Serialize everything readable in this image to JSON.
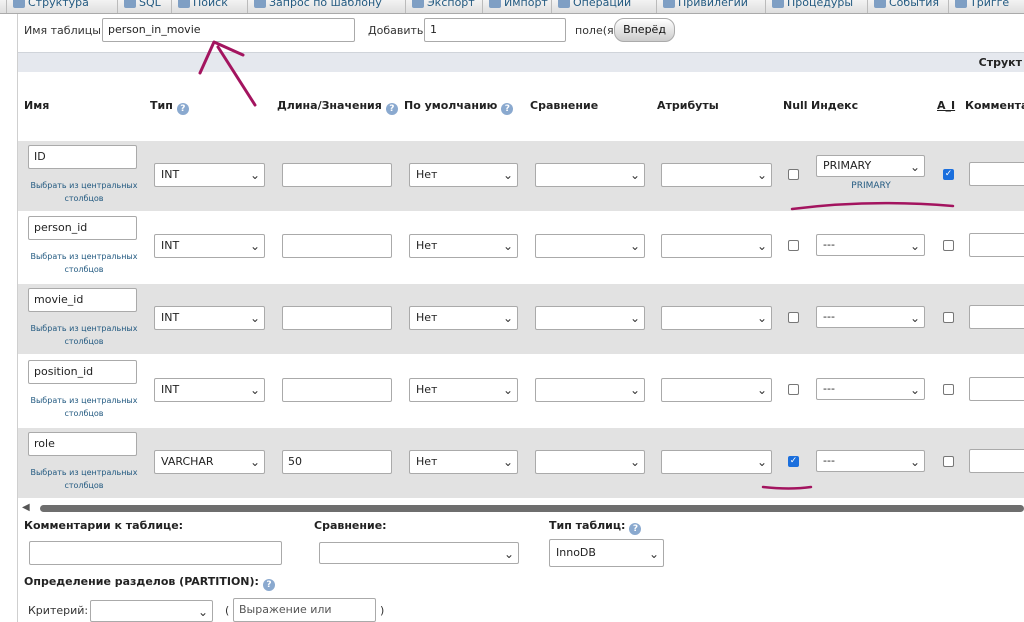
{
  "tabs": [
    {
      "label": "Структура",
      "icon": "structure-icon"
    },
    {
      "label": "SQL",
      "icon": "sql-icon"
    },
    {
      "label": "Поиск",
      "icon": "search-icon"
    },
    {
      "label": "Запрос по шаблону",
      "icon": "query-icon"
    },
    {
      "label": "Экспорт",
      "icon": "export-icon"
    },
    {
      "label": "Импорт",
      "icon": "import-icon"
    },
    {
      "label": "Операции",
      "icon": "wrench-icon"
    },
    {
      "label": "Привилегии",
      "icon": "privileges-icon"
    },
    {
      "label": "Процедуры",
      "icon": "routines-icon"
    },
    {
      "label": "События",
      "icon": "clock-icon"
    },
    {
      "label": "Тригге",
      "icon": "trigger-icon"
    }
  ],
  "form": {
    "table_name_label": "Имя таблицы:",
    "table_name_value": "person_in_movie",
    "add_label": "Добавить",
    "add_value": "1",
    "fields_label": "поле(я)",
    "go_button": "Вперёд"
  },
  "structure_label": "Структ",
  "headers": {
    "name": "Имя",
    "type": "Тип",
    "length": "Длина/Значения",
    "default": "По умолчанию",
    "collation": "Сравнение",
    "attributes": "Атрибуты",
    "null": "Null",
    "index": "Индекс",
    "ai": "A_I",
    "comment": "Комментар"
  },
  "central_columns_text": "Выбрать из центральных столбцов",
  "columns": [
    {
      "name": "ID",
      "type": "INT",
      "length": "",
      "default": "Нет",
      "collation": "",
      "attributes": "",
      "null": false,
      "index": "PRIMARY",
      "index_link": "PRIMARY",
      "ai": true
    },
    {
      "name": "person_id",
      "type": "INT",
      "length": "",
      "default": "Нет",
      "collation": "",
      "attributes": "",
      "null": false,
      "index": "---",
      "index_link": "",
      "ai": false
    },
    {
      "name": "movie_id",
      "type": "INT",
      "length": "",
      "default": "Нет",
      "collation": "",
      "attributes": "",
      "null": false,
      "index": "---",
      "index_link": "",
      "ai": false
    },
    {
      "name": "position_id",
      "type": "INT",
      "length": "",
      "default": "Нет",
      "collation": "",
      "attributes": "",
      "null": false,
      "index": "---",
      "index_link": "",
      "ai": false
    },
    {
      "name": "role",
      "type": "VARCHAR",
      "length": "50",
      "default": "Нет",
      "collation": "",
      "attributes": "",
      "null": true,
      "index": "---",
      "index_link": "",
      "ai": false
    }
  ],
  "bottom": {
    "table_comment_label": "Комментарии к таблице:",
    "collation_label": "Сравнение:",
    "engine_label": "Тип таблиц:",
    "engine_value": "InnoDB",
    "partition_label": "Определение разделов (PARTITION):",
    "criteria_label": "Критерий:",
    "expression_placeholder": "Выражение или перечень",
    "paren_open": "(",
    "paren_close": ")"
  },
  "colors": {
    "annotation": "#a3145f",
    "link": "#235a81",
    "row_gray": "#e2e2e2",
    "checkbox_on": "#1b6fdd"
  }
}
